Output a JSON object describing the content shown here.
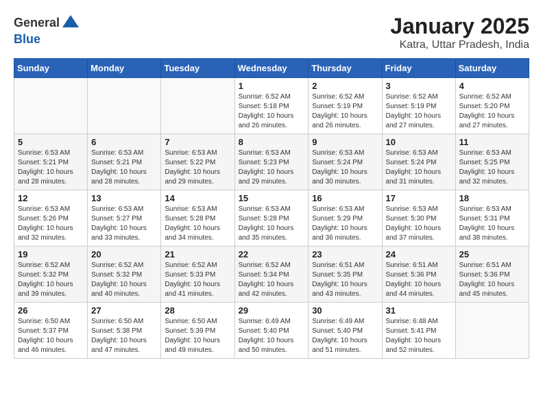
{
  "header": {
    "logo_line1": "General",
    "logo_line2": "Blue",
    "title": "January 2025",
    "subtitle": "Katra, Uttar Pradesh, India"
  },
  "weekdays": [
    "Sunday",
    "Monday",
    "Tuesday",
    "Wednesday",
    "Thursday",
    "Friday",
    "Saturday"
  ],
  "weeks": [
    [
      {
        "day": "",
        "info": ""
      },
      {
        "day": "",
        "info": ""
      },
      {
        "day": "",
        "info": ""
      },
      {
        "day": "1",
        "info": "Sunrise: 6:52 AM\nSunset: 5:18 PM\nDaylight: 10 hours and 26 minutes."
      },
      {
        "day": "2",
        "info": "Sunrise: 6:52 AM\nSunset: 5:19 PM\nDaylight: 10 hours and 26 minutes."
      },
      {
        "day": "3",
        "info": "Sunrise: 6:52 AM\nSunset: 5:19 PM\nDaylight: 10 hours and 27 minutes."
      },
      {
        "day": "4",
        "info": "Sunrise: 6:52 AM\nSunset: 5:20 PM\nDaylight: 10 hours and 27 minutes."
      }
    ],
    [
      {
        "day": "5",
        "info": "Sunrise: 6:53 AM\nSunset: 5:21 PM\nDaylight: 10 hours and 28 minutes."
      },
      {
        "day": "6",
        "info": "Sunrise: 6:53 AM\nSunset: 5:21 PM\nDaylight: 10 hours and 28 minutes."
      },
      {
        "day": "7",
        "info": "Sunrise: 6:53 AM\nSunset: 5:22 PM\nDaylight: 10 hours and 29 minutes."
      },
      {
        "day": "8",
        "info": "Sunrise: 6:53 AM\nSunset: 5:23 PM\nDaylight: 10 hours and 29 minutes."
      },
      {
        "day": "9",
        "info": "Sunrise: 6:53 AM\nSunset: 5:24 PM\nDaylight: 10 hours and 30 minutes."
      },
      {
        "day": "10",
        "info": "Sunrise: 6:53 AM\nSunset: 5:24 PM\nDaylight: 10 hours and 31 minutes."
      },
      {
        "day": "11",
        "info": "Sunrise: 6:53 AM\nSunset: 5:25 PM\nDaylight: 10 hours and 32 minutes."
      }
    ],
    [
      {
        "day": "12",
        "info": "Sunrise: 6:53 AM\nSunset: 5:26 PM\nDaylight: 10 hours and 32 minutes."
      },
      {
        "day": "13",
        "info": "Sunrise: 6:53 AM\nSunset: 5:27 PM\nDaylight: 10 hours and 33 minutes."
      },
      {
        "day": "14",
        "info": "Sunrise: 6:53 AM\nSunset: 5:28 PM\nDaylight: 10 hours and 34 minutes."
      },
      {
        "day": "15",
        "info": "Sunrise: 6:53 AM\nSunset: 5:28 PM\nDaylight: 10 hours and 35 minutes."
      },
      {
        "day": "16",
        "info": "Sunrise: 6:53 AM\nSunset: 5:29 PM\nDaylight: 10 hours and 36 minutes."
      },
      {
        "day": "17",
        "info": "Sunrise: 6:53 AM\nSunset: 5:30 PM\nDaylight: 10 hours and 37 minutes."
      },
      {
        "day": "18",
        "info": "Sunrise: 6:53 AM\nSunset: 5:31 PM\nDaylight: 10 hours and 38 minutes."
      }
    ],
    [
      {
        "day": "19",
        "info": "Sunrise: 6:52 AM\nSunset: 5:32 PM\nDaylight: 10 hours and 39 minutes."
      },
      {
        "day": "20",
        "info": "Sunrise: 6:52 AM\nSunset: 5:32 PM\nDaylight: 10 hours and 40 minutes."
      },
      {
        "day": "21",
        "info": "Sunrise: 6:52 AM\nSunset: 5:33 PM\nDaylight: 10 hours and 41 minutes."
      },
      {
        "day": "22",
        "info": "Sunrise: 6:52 AM\nSunset: 5:34 PM\nDaylight: 10 hours and 42 minutes."
      },
      {
        "day": "23",
        "info": "Sunrise: 6:51 AM\nSunset: 5:35 PM\nDaylight: 10 hours and 43 minutes."
      },
      {
        "day": "24",
        "info": "Sunrise: 6:51 AM\nSunset: 5:36 PM\nDaylight: 10 hours and 44 minutes."
      },
      {
        "day": "25",
        "info": "Sunrise: 6:51 AM\nSunset: 5:36 PM\nDaylight: 10 hours and 45 minutes."
      }
    ],
    [
      {
        "day": "26",
        "info": "Sunrise: 6:50 AM\nSunset: 5:37 PM\nDaylight: 10 hours and 46 minutes."
      },
      {
        "day": "27",
        "info": "Sunrise: 6:50 AM\nSunset: 5:38 PM\nDaylight: 10 hours and 47 minutes."
      },
      {
        "day": "28",
        "info": "Sunrise: 6:50 AM\nSunset: 5:39 PM\nDaylight: 10 hours and 49 minutes."
      },
      {
        "day": "29",
        "info": "Sunrise: 6:49 AM\nSunset: 5:40 PM\nDaylight: 10 hours and 50 minutes."
      },
      {
        "day": "30",
        "info": "Sunrise: 6:49 AM\nSunset: 5:40 PM\nDaylight: 10 hours and 51 minutes."
      },
      {
        "day": "31",
        "info": "Sunrise: 6:48 AM\nSunset: 5:41 PM\nDaylight: 10 hours and 52 minutes."
      },
      {
        "day": "",
        "info": ""
      }
    ]
  ]
}
